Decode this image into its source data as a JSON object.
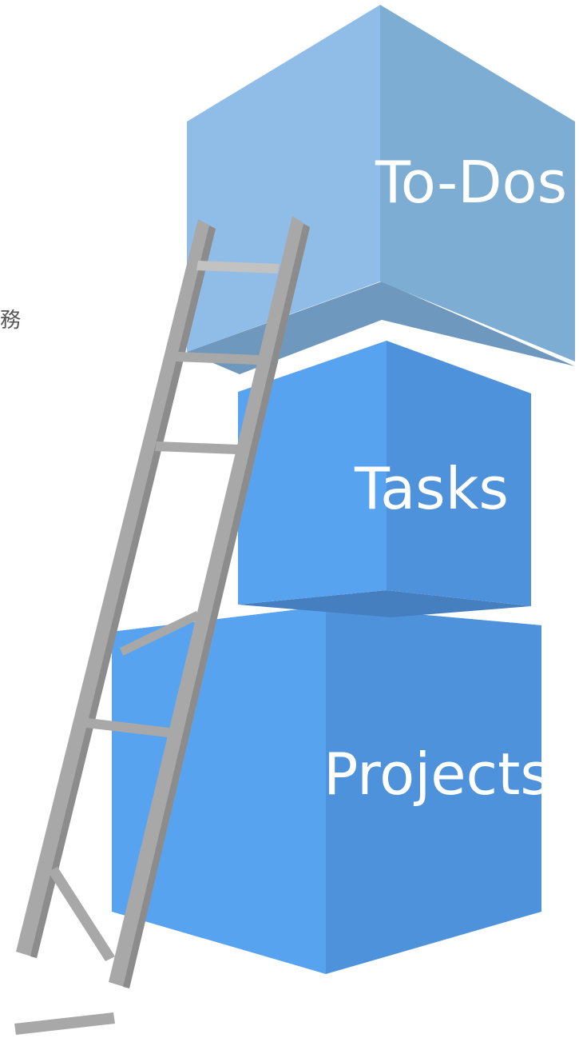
{
  "diagram": {
    "blocks": {
      "top": {
        "label": "To-Dos",
        "colors": {
          "front": "#8fbde8",
          "side": "#7eadd4",
          "bottom": "#6e98bd"
        }
      },
      "middle": {
        "label": "Tasks",
        "colors": {
          "front": "#57a3f0",
          "side": "#4f92dc",
          "bottom": "#467fbf"
        }
      },
      "bottom": {
        "label": "Projects",
        "colors": {
          "front": "#57a3f0",
          "side": "#4f92dc",
          "top": "#4a86cc"
        }
      }
    },
    "side_text": "務",
    "ladder": {
      "color": "#a8a8a8",
      "shade": "#8c8c8c",
      "highlight": "#c2c2c2"
    }
  }
}
